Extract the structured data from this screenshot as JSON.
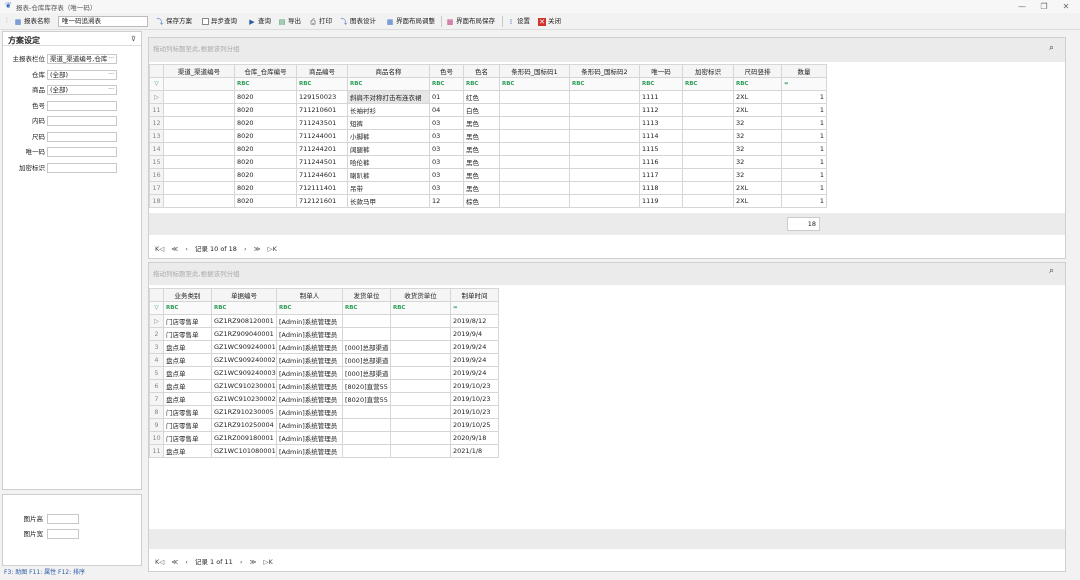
{
  "window": {
    "title": "报表-仓库库存表（唯一码）",
    "min": "—",
    "restore": "❐",
    "close": "✕"
  },
  "toolbar": {
    "report_name_label": "报表名称",
    "report_name_value": "唯一码追溯表",
    "save_scheme": "保存方案",
    "async_query": "异步查询",
    "query": "查询",
    "export": "导出",
    "print": "打印",
    "chart_design": "图表设计",
    "layout_adjust": "界面布局调整",
    "layout_save": "界面布局保存",
    "settings": "设置",
    "close": "关闭"
  },
  "scheme": {
    "title": "方案设定",
    "pin": "⊽",
    "fields": [
      {
        "label": "主报表栏位",
        "value": "渠道_渠道编号,仓库",
        "dots": "···"
      },
      {
        "label": "仓库",
        "value": "(全部)",
        "dots": "···"
      },
      {
        "label": "商品",
        "value": "(全部)",
        "dots": "···"
      },
      {
        "label": "色号",
        "value": ""
      },
      {
        "label": "内码",
        "value": ""
      },
      {
        "label": "尺码",
        "value": ""
      },
      {
        "label": "唯一码",
        "value": ""
      },
      {
        "label": "加密标识",
        "value": ""
      }
    ],
    "image_fields": [
      {
        "label": "图片高",
        "value": ""
      },
      {
        "label": "图片宽",
        "value": ""
      }
    ]
  },
  "status_bar": "F3: 助图   F11: 属性   F12: 排序",
  "top_grid": {
    "hint": "拖动列标题至此,根据该列分组",
    "columns": [
      "渠道_渠道编号",
      "仓库_仓库编号",
      "商品编号",
      "商品名称",
      "色号",
      "色名",
      "条形码_国标码1",
      "条形码_国标码2",
      "唯一码",
      "加密标识",
      "尺码竖排",
      "数量"
    ],
    "filter_row": [
      "",
      "RBC",
      "RBC",
      "RBC",
      "RBC",
      "RBC",
      "RBC",
      "RBC",
      "RBC",
      "RBC",
      "RBC",
      "="
    ],
    "rows": [
      {
        "n": "▷",
        "c": [
          "",
          "8020",
          "129150023",
          "斜肩不对称打击布连衣裙",
          "01",
          "红色",
          "",
          "",
          "1111",
          "",
          "2XL",
          "1"
        ]
      },
      {
        "n": "11",
        "c": [
          "",
          "8020",
          "711210601",
          "长袖衬衫",
          "04",
          "白色",
          "",
          "",
          "1112",
          "",
          "2XL",
          "1"
        ]
      },
      {
        "n": "12",
        "c": [
          "",
          "8020",
          "711243501",
          "短裤",
          "03",
          "黑色",
          "",
          "",
          "1113",
          "",
          "32",
          "1"
        ]
      },
      {
        "n": "13",
        "c": [
          "",
          "8020",
          "711244001",
          "小脚裤",
          "03",
          "黑色",
          "",
          "",
          "1114",
          "",
          "32",
          "1"
        ]
      },
      {
        "n": "14",
        "c": [
          "",
          "8020",
          "711244201",
          "阔腿裤",
          "03",
          "黑色",
          "",
          "",
          "1115",
          "",
          "32",
          "1"
        ]
      },
      {
        "n": "15",
        "c": [
          "",
          "8020",
          "711244501",
          "哈伦裤",
          "03",
          "黑色",
          "",
          "",
          "1116",
          "",
          "32",
          "1"
        ]
      },
      {
        "n": "16",
        "c": [
          "",
          "8020",
          "711244601",
          "喇叭裤",
          "03",
          "黑色",
          "",
          "",
          "1117",
          "",
          "32",
          "1"
        ]
      },
      {
        "n": "17",
        "c": [
          "",
          "8020",
          "712111401",
          "吊带",
          "03",
          "黑色",
          "",
          "",
          "1118",
          "",
          "2XL",
          "1"
        ]
      },
      {
        "n": "18",
        "c": [
          "",
          "8020",
          "712121601",
          "长款马甲",
          "12",
          "棕色",
          "",
          "",
          "1119",
          "",
          "2XL",
          "1"
        ]
      }
    ],
    "total": "18",
    "pager": {
      "first": "K◁",
      "prev_page": "≪",
      "prev": "‹",
      "record": "记录 10 of 18",
      "next": "›",
      "next_page": "≫",
      "last": "▷K"
    }
  },
  "bottom_grid": {
    "hint": "拖动列标题至此,根据该列分组",
    "columns": [
      "业务类别",
      "单据编号",
      "制单人",
      "发货单位",
      "收货货单位",
      "制单时间"
    ],
    "filter_row": [
      "RBC",
      "RBC",
      "RBC",
      "RBC",
      "RBC",
      "="
    ],
    "rows": [
      {
        "n": "▷",
        "c": [
          "门店零售单",
          "GZ1RZ908120001",
          "[Admin]系统管理员",
          "",
          "",
          "2019/8/12"
        ]
      },
      {
        "n": "2",
        "c": [
          "门店零售单",
          "GZ1RZ909040001",
          "[Admin]系统管理员",
          "",
          "",
          "2019/9/4"
        ]
      },
      {
        "n": "3",
        "c": [
          "盘点单",
          "GZ1WC909240001",
          "[Admin]系统管理员",
          "[000]总部渠道",
          "",
          "2019/9/24"
        ]
      },
      {
        "n": "4",
        "c": [
          "盘点单",
          "GZ1WC909240002",
          "[Admin]系统管理员",
          "[000]总部渠道",
          "",
          "2019/9/24"
        ]
      },
      {
        "n": "5",
        "c": [
          "盘点单",
          "GZ1WC909240003",
          "[Admin]系统管理员",
          "[000]总部渠道",
          "",
          "2019/9/24"
        ]
      },
      {
        "n": "6",
        "c": [
          "盘点单",
          "GZ1WC910230001",
          "[Admin]系统管理员",
          "[8020]直营55",
          "",
          "2019/10/23"
        ]
      },
      {
        "n": "7",
        "c": [
          "盘点单",
          "GZ1WC910230002",
          "[Admin]系统管理员",
          "[8020]直营55",
          "",
          "2019/10/23"
        ]
      },
      {
        "n": "8",
        "c": [
          "门店零售单",
          "GZ1RZ910230005",
          "[Admin]系统管理员",
          "",
          "",
          "2019/10/23"
        ]
      },
      {
        "n": "9",
        "c": [
          "门店零售单",
          "GZ1RZ910250004",
          "[Admin]系统管理员",
          "",
          "",
          "2019/10/25"
        ]
      },
      {
        "n": "10",
        "c": [
          "门店零售单",
          "GZ1RZ009180001",
          "[Admin]系统管理员",
          "",
          "",
          "2020/9/18"
        ]
      },
      {
        "n": "11",
        "c": [
          "盘点单",
          "GZ1WC101080001",
          "[Admin]系统管理员",
          "",
          "",
          "2021/1/8"
        ]
      }
    ],
    "pager": {
      "first": "K◁",
      "prev_page": "≪",
      "prev": "‹",
      "record": "记录 1 of 11",
      "next": "›",
      "next_page": "≫",
      "last": "▷K"
    }
  },
  "colors": {
    "accent": "#2a5aa8",
    "filter_green": "#2a9a55"
  }
}
